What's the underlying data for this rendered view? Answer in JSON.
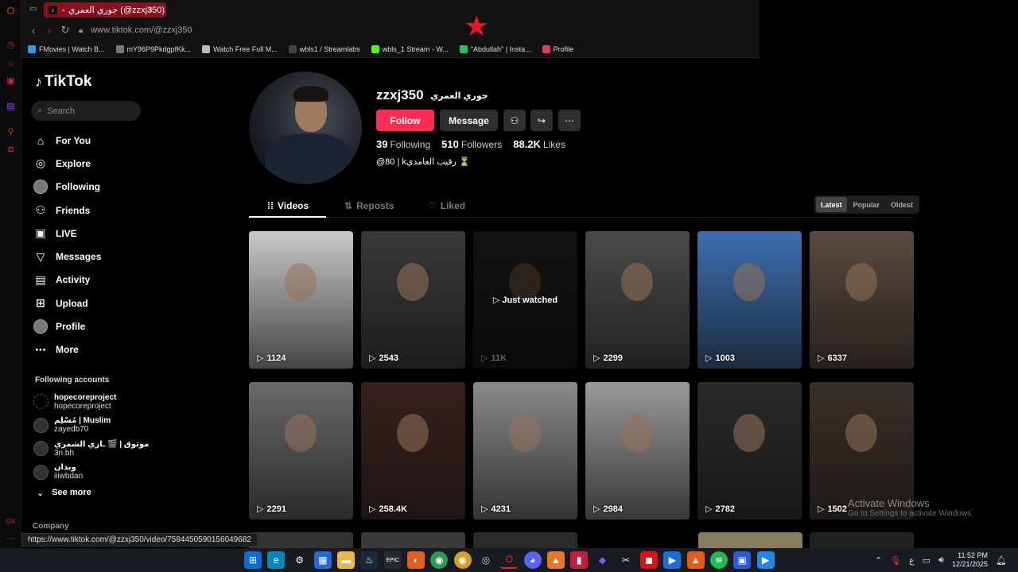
{
  "browser": {
    "tab_title": "جوري العمري (@zzxj350)",
    "tab_favicon": "tiktok-icon",
    "url": "www.tiktok.com/@zzxj350",
    "bookmarks": [
      {
        "label": "FMovies | Watch B...",
        "color": "#2f9be6"
      },
      {
        "label": "mY96P9PkdgpfKk...",
        "color": "#777777"
      },
      {
        "label": "Watch Free Full M...",
        "color": "#bbbbbb"
      },
      {
        "label": "wbls1 / Streamlabs",
        "color": "#444444"
      },
      {
        "label": "wbls_1 Stream - W...",
        "color": "#53fc18"
      },
      {
        "label": "\"Abdullah\" | Insta...",
        "color": "#22c55e"
      },
      {
        "label": "Profile",
        "color": "#e33b5f"
      }
    ],
    "status_url": "https://www.tiktok.com/@zzxj350/video/7584450590156049682"
  },
  "sidebar": {
    "logo": "TikTok",
    "search_placeholder": "Search",
    "menu": [
      {
        "label": "For You",
        "icon": "home-icon"
      },
      {
        "label": "Explore",
        "icon": "compass-icon"
      },
      {
        "label": "Following",
        "icon": "avatar-icon"
      },
      {
        "label": "Friends",
        "icon": "friends-icon"
      },
      {
        "label": "LIVE",
        "icon": "live-icon"
      },
      {
        "label": "Messages",
        "icon": "messages-icon"
      },
      {
        "label": "Activity",
        "icon": "activity-icon"
      },
      {
        "label": "Upload",
        "icon": "upload-icon"
      },
      {
        "label": "Profile",
        "icon": "profile-avatar-icon"
      },
      {
        "label": "More",
        "icon": "more-icon"
      }
    ],
    "following_title": "Following accounts",
    "following_accounts": [
      {
        "name": "hopecoreproject",
        "handle": "hopecoreproject"
      },
      {
        "name": "مُسْلِم | Muslim",
        "handle": "zayedb70"
      },
      {
        "name": "موثوق | 🎬 ـازي الشمري",
        "handle": "3n.bh"
      },
      {
        "name": "وبدان",
        "handle": "iiiwbdan"
      }
    ],
    "see_more": "See more",
    "company": "Company"
  },
  "profile": {
    "username": "zzxj350",
    "nickname": "جوري العمري",
    "follow_label": "Follow",
    "message_label": "Message",
    "following_count": "39",
    "following_label": "Following",
    "followers_count": "510",
    "followers_label": "Followers",
    "likes_count": "88.2K",
    "likes_label": "Likes",
    "bio": "@80 | kرقيب الغامدي ⏳"
  },
  "tabs": {
    "videos": "Videos",
    "reposts": "Reposts",
    "liked": "Liked",
    "sort": [
      "Latest",
      "Popular",
      "Oldest"
    ],
    "sort_active": "Latest"
  },
  "videos": [
    {
      "views": "1124",
      "bg": "#c9c9c9"
    },
    {
      "views": "2543",
      "bg": "#3a3a3a"
    },
    {
      "views": "11K",
      "bg": "#2b2b2b",
      "label": "Just watched"
    },
    {
      "views": "2299",
      "bg": "#4a4a4a"
    },
    {
      "views": "1003",
      "bg": "#3b6fb0"
    },
    {
      "views": "6337",
      "bg": "#5a4a40"
    },
    {
      "views": "2291",
      "bg": "#6a6a6a"
    },
    {
      "views": "258.4K",
      "bg": "#3a1f1f"
    },
    {
      "views": "4231",
      "bg": "#8a8a8a"
    },
    {
      "views": "2984",
      "bg": "#9a9a9a"
    },
    {
      "views": "2782",
      "bg": "#2a2a2a"
    },
    {
      "views": "1502",
      "bg": "#3a2f2a"
    }
  ],
  "windows_watermark": {
    "title": "Activate Windows",
    "subtitle": "Go to Settings to activate Windows."
  },
  "clock": {
    "time": "11:52 PM",
    "date": "12/21/2025"
  },
  "tray_lang": "ع"
}
